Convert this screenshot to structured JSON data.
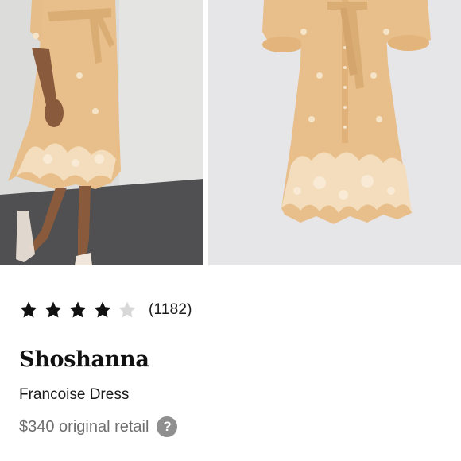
{
  "product": {
    "rating": {
      "value": 4,
      "max": 5,
      "count_label": "(1182)"
    },
    "brand": "Shoshanna",
    "name": "Francoise Dress",
    "price_label": "$340 original retail"
  },
  "icons": {
    "star_filled": "star-icon",
    "star_empty": "star-outline-icon",
    "help": "question-mark-icon"
  },
  "colors": {
    "dress": "#e8bf8a",
    "embroidery": "#f5e4c8",
    "star_filled": "#111111",
    "star_empty": "#d8d8d8",
    "price_text": "#6e6e6e",
    "help_icon_bg": "#8f8f8f"
  },
  "help_glyph": "?"
}
